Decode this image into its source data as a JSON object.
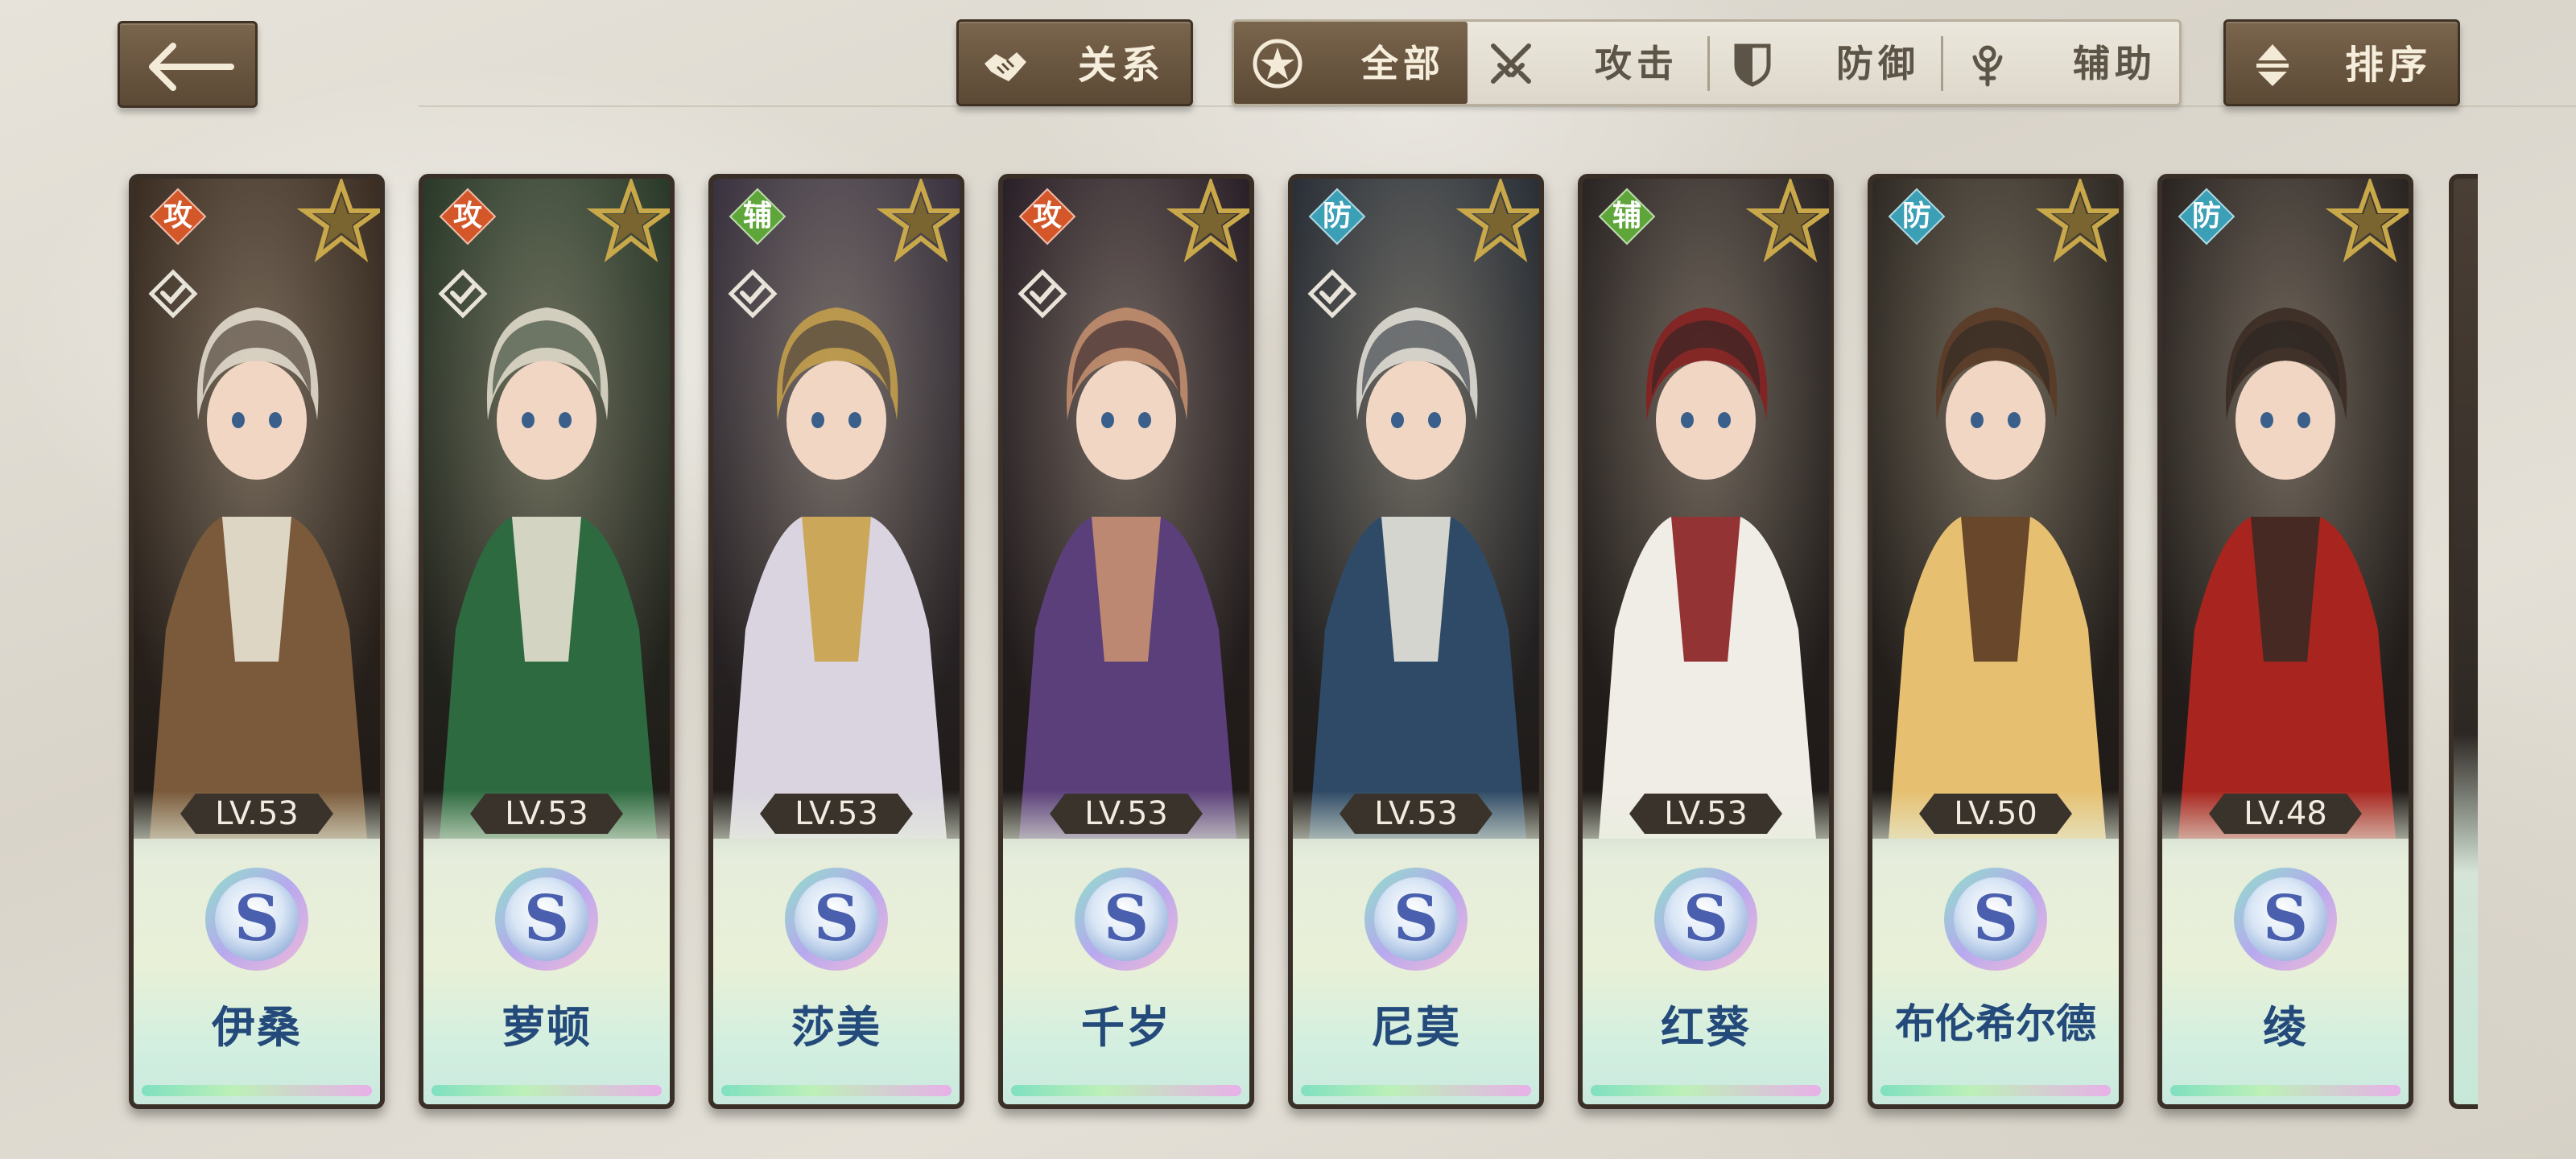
{
  "header": {
    "back_label": "",
    "relation_label": "关系",
    "sort_label": "排序",
    "filters": [
      {
        "label": "全部",
        "icon": "star-circle-icon",
        "active": true
      },
      {
        "label": "攻击",
        "icon": "crossed-swords-icon",
        "active": false
      },
      {
        "label": "防御",
        "icon": "shield-icon",
        "active": false
      },
      {
        "label": "辅助",
        "icon": "support-staff-icon",
        "active": false
      }
    ]
  },
  "role_colors": {
    "攻": "#d4572a",
    "防": "#3b9fb6",
    "辅": "#5fa63a"
  },
  "characters": [
    {
      "name": "伊桑",
      "level": "LV.53",
      "role": "攻",
      "rank": "S",
      "selected_check": true,
      "palette": [
        "#3b2d22",
        "#7a5a3a",
        "#e9e3d5"
      ]
    },
    {
      "name": "萝顿",
      "level": "LV.53",
      "role": "攻",
      "rank": "S",
      "selected_check": true,
      "palette": [
        "#2a3a2a",
        "#2e6a40",
        "#e6e0d0"
      ]
    },
    {
      "name": "莎美",
      "level": "LV.53",
      "role": "辅",
      "rank": "S",
      "selected_check": true,
      "palette": [
        "#3a3340",
        "#d9d4e0",
        "#c8a24a"
      ]
    },
    {
      "name": "千岁",
      "level": "LV.53",
      "role": "攻",
      "rank": "S",
      "selected_check": true,
      "palette": [
        "#2a2028",
        "#5b3f7a",
        "#c89070"
      ]
    },
    {
      "name": "尼莫",
      "level": "LV.53",
      "role": "防",
      "rank": "S",
      "selected_check": true,
      "palette": [
        "#2a3038",
        "#2f4a66",
        "#e8e4dc"
      ]
    },
    {
      "name": "红葵",
      "level": "LV.53",
      "role": "辅",
      "rank": "S",
      "selected_check": false,
      "palette": [
        "#2a2424",
        "#f0ece6",
        "#8a1f1f"
      ]
    },
    {
      "name": "布伦希尔德",
      "level": "LV.50",
      "role": "防",
      "rank": "S",
      "selected_check": false,
      "palette": [
        "#2f2a24",
        "#e6c070",
        "#5a3a24"
      ]
    },
    {
      "name": "绫",
      "level": "LV.48",
      "role": "防",
      "rank": "S",
      "selected_check": false,
      "palette": [
        "#2a2422",
        "#a8241e",
        "#3a2a22"
      ]
    }
  ]
}
